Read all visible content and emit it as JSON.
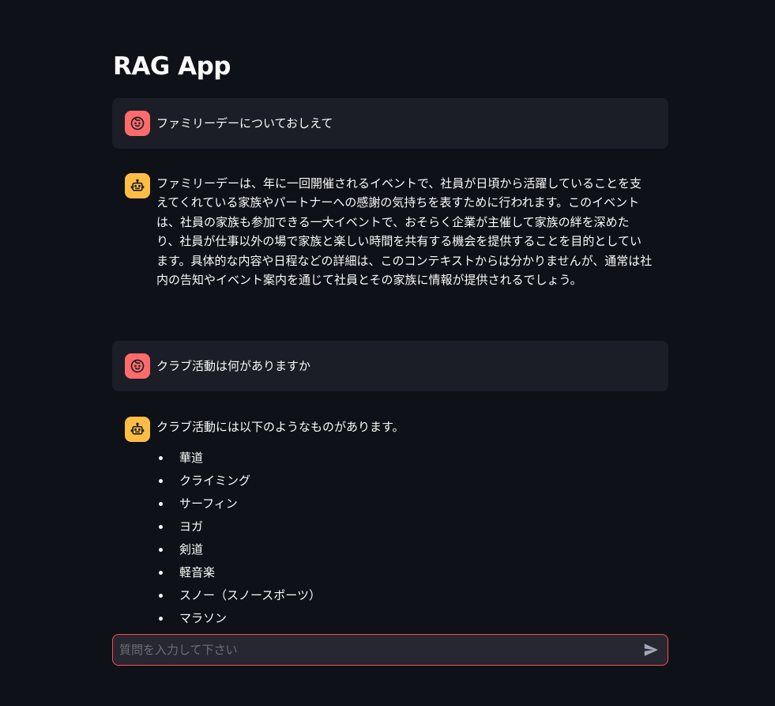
{
  "app": {
    "title": "RAG App"
  },
  "messages": [
    {
      "role": "user",
      "avatar_icon": "user-face-icon",
      "text": "ファミリーデーについておしえて"
    },
    {
      "role": "assistant",
      "avatar_icon": "robot-icon",
      "text": "ファミリーデーは、年に一回開催されるイベントで、社員が日頃から活躍していることを支えてくれている家族やパートナーへの感謝の気持ちを表すために行われます。このイベントは、社員の家族も参加できる一大イベントで、おそらく企業が主催して家族の絆を深めたり、社員が仕事以外の場で家族と楽しい時間を共有する機会を提供することを目的としています。具体的な内容や日程などの詳細は、このコンテキストからは分かりませんが、通常は社内の告知やイベント案内を通じて社員とその家族に情報が提供されるでしょう。"
    },
    {
      "role": "user",
      "avatar_icon": "user-face-icon",
      "text": "クラブ活動は何がありますか"
    },
    {
      "role": "assistant",
      "avatar_icon": "robot-icon",
      "text": "クラブ活動には以下のようなものがあります。",
      "items": [
        "華道",
        "クライミング",
        "サーフィン",
        "ヨガ",
        "剣道",
        "軽音楽",
        "スノー（スノースポーツ）",
        "マラソン"
      ]
    }
  ],
  "chat_input": {
    "placeholder": "質問を入力して下さい",
    "value": "",
    "send_icon": "send-icon"
  },
  "colors": {
    "background": "#0e1117",
    "user_message_bg": "#1b1e26",
    "user_avatar": "#ff6b6b",
    "assistant_avatar": "#ffbd45",
    "input_border": "#ff4b4b",
    "input_bg": "#262730"
  }
}
